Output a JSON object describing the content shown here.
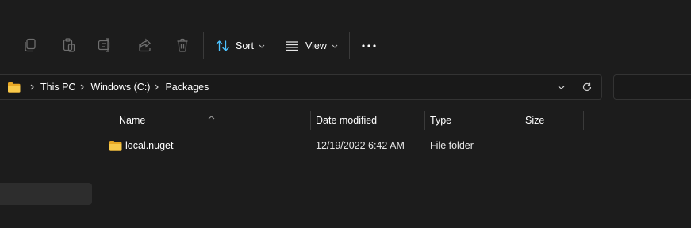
{
  "toolbar": {
    "icons": [
      "copy-icon",
      "paste-icon",
      "rename-icon",
      "share-icon",
      "delete-icon"
    ],
    "sort_label": "Sort",
    "view_label": "View",
    "more_label": "•••"
  },
  "address": {
    "crumbs": [
      "This PC",
      "Windows (C:)",
      "Packages"
    ]
  },
  "columns": {
    "name": "Name",
    "date_modified": "Date modified",
    "type": "Type",
    "size": "Size"
  },
  "rows": [
    {
      "name": "local.nuget",
      "date_modified": "12/19/2022 6:42 AM",
      "type": "File folder",
      "size": ""
    }
  ],
  "colors": {
    "background": "#1c1c1c",
    "folder_yellow": "#f4c543",
    "accent_blue": "#4cc2ff",
    "icon_dim": "#6e6e6e"
  }
}
